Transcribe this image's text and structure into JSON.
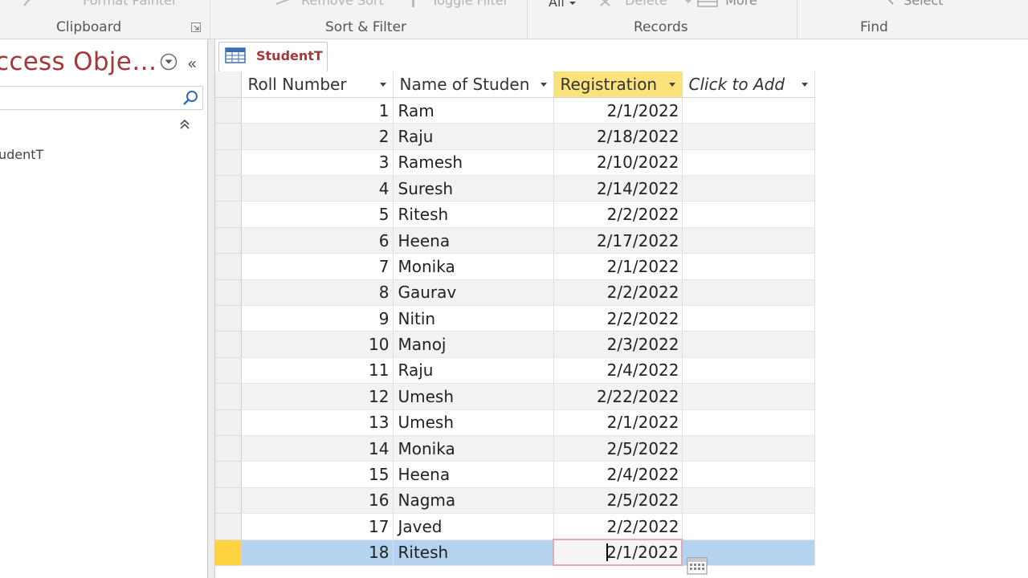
{
  "ribbon": {
    "cut_top_items": {
      "format_painter": "Format Painter",
      "remove_sort": "Remove Sort",
      "toggle_filter": "Toggle Filter",
      "all": "All",
      "delete": "Delete",
      "more": "More",
      "select": "Select"
    },
    "groups": {
      "clipboard": "Clipboard",
      "sort_filter": "Sort & Filter",
      "records": "Records",
      "find": "Find"
    }
  },
  "nav": {
    "title": "ccess Obje…",
    "search_placeholder": "",
    "item": "udentT"
  },
  "doc_tab": {
    "label": "StudentT"
  },
  "datasheet": {
    "columns": [
      "Roll Number",
      "Name of Studen",
      "Registration",
      "Click to Add"
    ],
    "rows": [
      {
        "roll": "1",
        "name": "Ram",
        "reg": "2/1/2022"
      },
      {
        "roll": "2",
        "name": "Raju",
        "reg": "2/18/2022"
      },
      {
        "roll": "3",
        "name": "Ramesh",
        "reg": "2/10/2022"
      },
      {
        "roll": "4",
        "name": "Suresh",
        "reg": "2/14/2022"
      },
      {
        "roll": "5",
        "name": "Ritesh",
        "reg": "2/2/2022"
      },
      {
        "roll": "6",
        "name": "Heena",
        "reg": "2/17/2022"
      },
      {
        "roll": "7",
        "name": "Monika",
        "reg": "2/1/2022"
      },
      {
        "roll": "8",
        "name": "Gaurav",
        "reg": "2/2/2022"
      },
      {
        "roll": "9",
        "name": "Nitin",
        "reg": "2/2/2022"
      },
      {
        "roll": "10",
        "name": "Manoj",
        "reg": "2/3/2022"
      },
      {
        "roll": "11",
        "name": "Raju",
        "reg": "2/4/2022"
      },
      {
        "roll": "12",
        "name": "Umesh",
        "reg": "2/22/2022"
      },
      {
        "roll": "13",
        "name": "Umesh",
        "reg": "2/1/2022"
      },
      {
        "roll": "14",
        "name": "Monika",
        "reg": "2/5/2022"
      },
      {
        "roll": "15",
        "name": "Heena",
        "reg": "2/4/2022"
      },
      {
        "roll": "16",
        "name": "Nagma",
        "reg": "2/5/2022"
      },
      {
        "roll": "17",
        "name": "Javed",
        "reg": "2/2/2022"
      },
      {
        "roll": "18",
        "name": "Ritesh",
        "reg": "2/1/2022"
      }
    ],
    "current_row": 18
  },
  "colors": {
    "accent": "#a4373a",
    "selected_header": "#fbe27a",
    "current_row": "#b5d2ee",
    "record_selector_current": "#ffd33f"
  }
}
